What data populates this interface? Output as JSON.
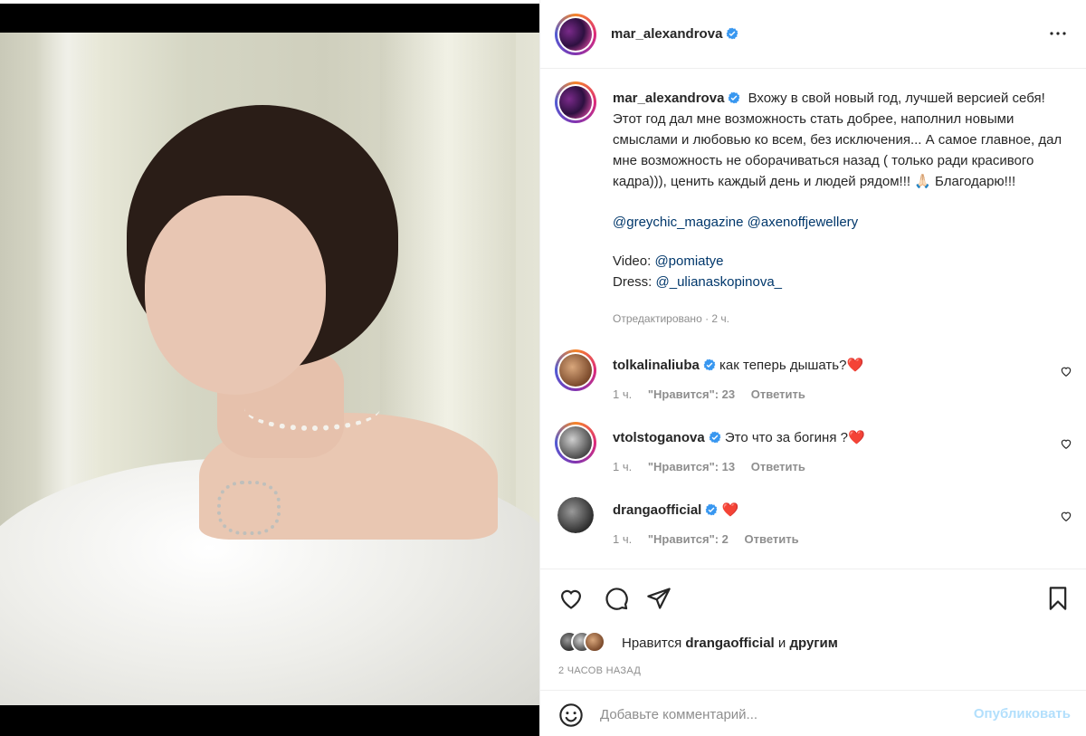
{
  "post": {
    "author": "mar_alexandrova",
    "caption_line1": "Вхожу в свой новый год, лучшей версией себя! Этот год дал мне возможность стать добрее, наполнил новыми смыслами и любовью ко всем, без исключения... А самое главное, дал мне возможность не оборачиваться назад ( только ради красивого кадра))), ценить каждый день и людей рядом!!! 🙏🏻 Благодарю!!!",
    "mentions_line": [
      "@greychic_magazine",
      "@axenoffjewellery"
    ],
    "video_label": "Video: ",
    "video_mention": "@pomiatye",
    "dress_label": "Dress: ",
    "dress_mention": "@_ulianaskopinova_",
    "edited_meta": "Отредактировано · 2 ч."
  },
  "comments": [
    {
      "user": "tolkalinaliuba",
      "text": "как теперь дышать?",
      "emoji": "❤️",
      "time": "1 ч.",
      "likes": "\"Нравится\": 23",
      "reply": "Ответить"
    },
    {
      "user": "vtolstoganova",
      "text": "Это что за богиня ?",
      "emoji": "❤️",
      "time": "1 ч.",
      "likes": "\"Нравится\": 13",
      "reply": "Ответить"
    },
    {
      "user": "drangaofficial",
      "text": "",
      "emoji": "❤️",
      "time": "1 ч.",
      "likes": "\"Нравится\": 2",
      "reply": "Ответить"
    }
  ],
  "likes": {
    "prefix": "Нравится",
    "user": "drangaofficial",
    "conj": "и",
    "others": "другим"
  },
  "timestamp": "2 ЧАСОВ НАЗАД",
  "composer": {
    "placeholder": "Добавьте комментарий...",
    "publish_label": "Опубликовать"
  },
  "colors": {
    "link": "#00376b",
    "verified": "#3897f0",
    "publish_disabled": "#b2dffc",
    "heart": "#ed2b3d"
  },
  "icons": [
    "more-icon",
    "heart-icon",
    "comment-icon",
    "share-icon",
    "bookmark-icon",
    "emoji-icon",
    "verified-icon"
  ]
}
